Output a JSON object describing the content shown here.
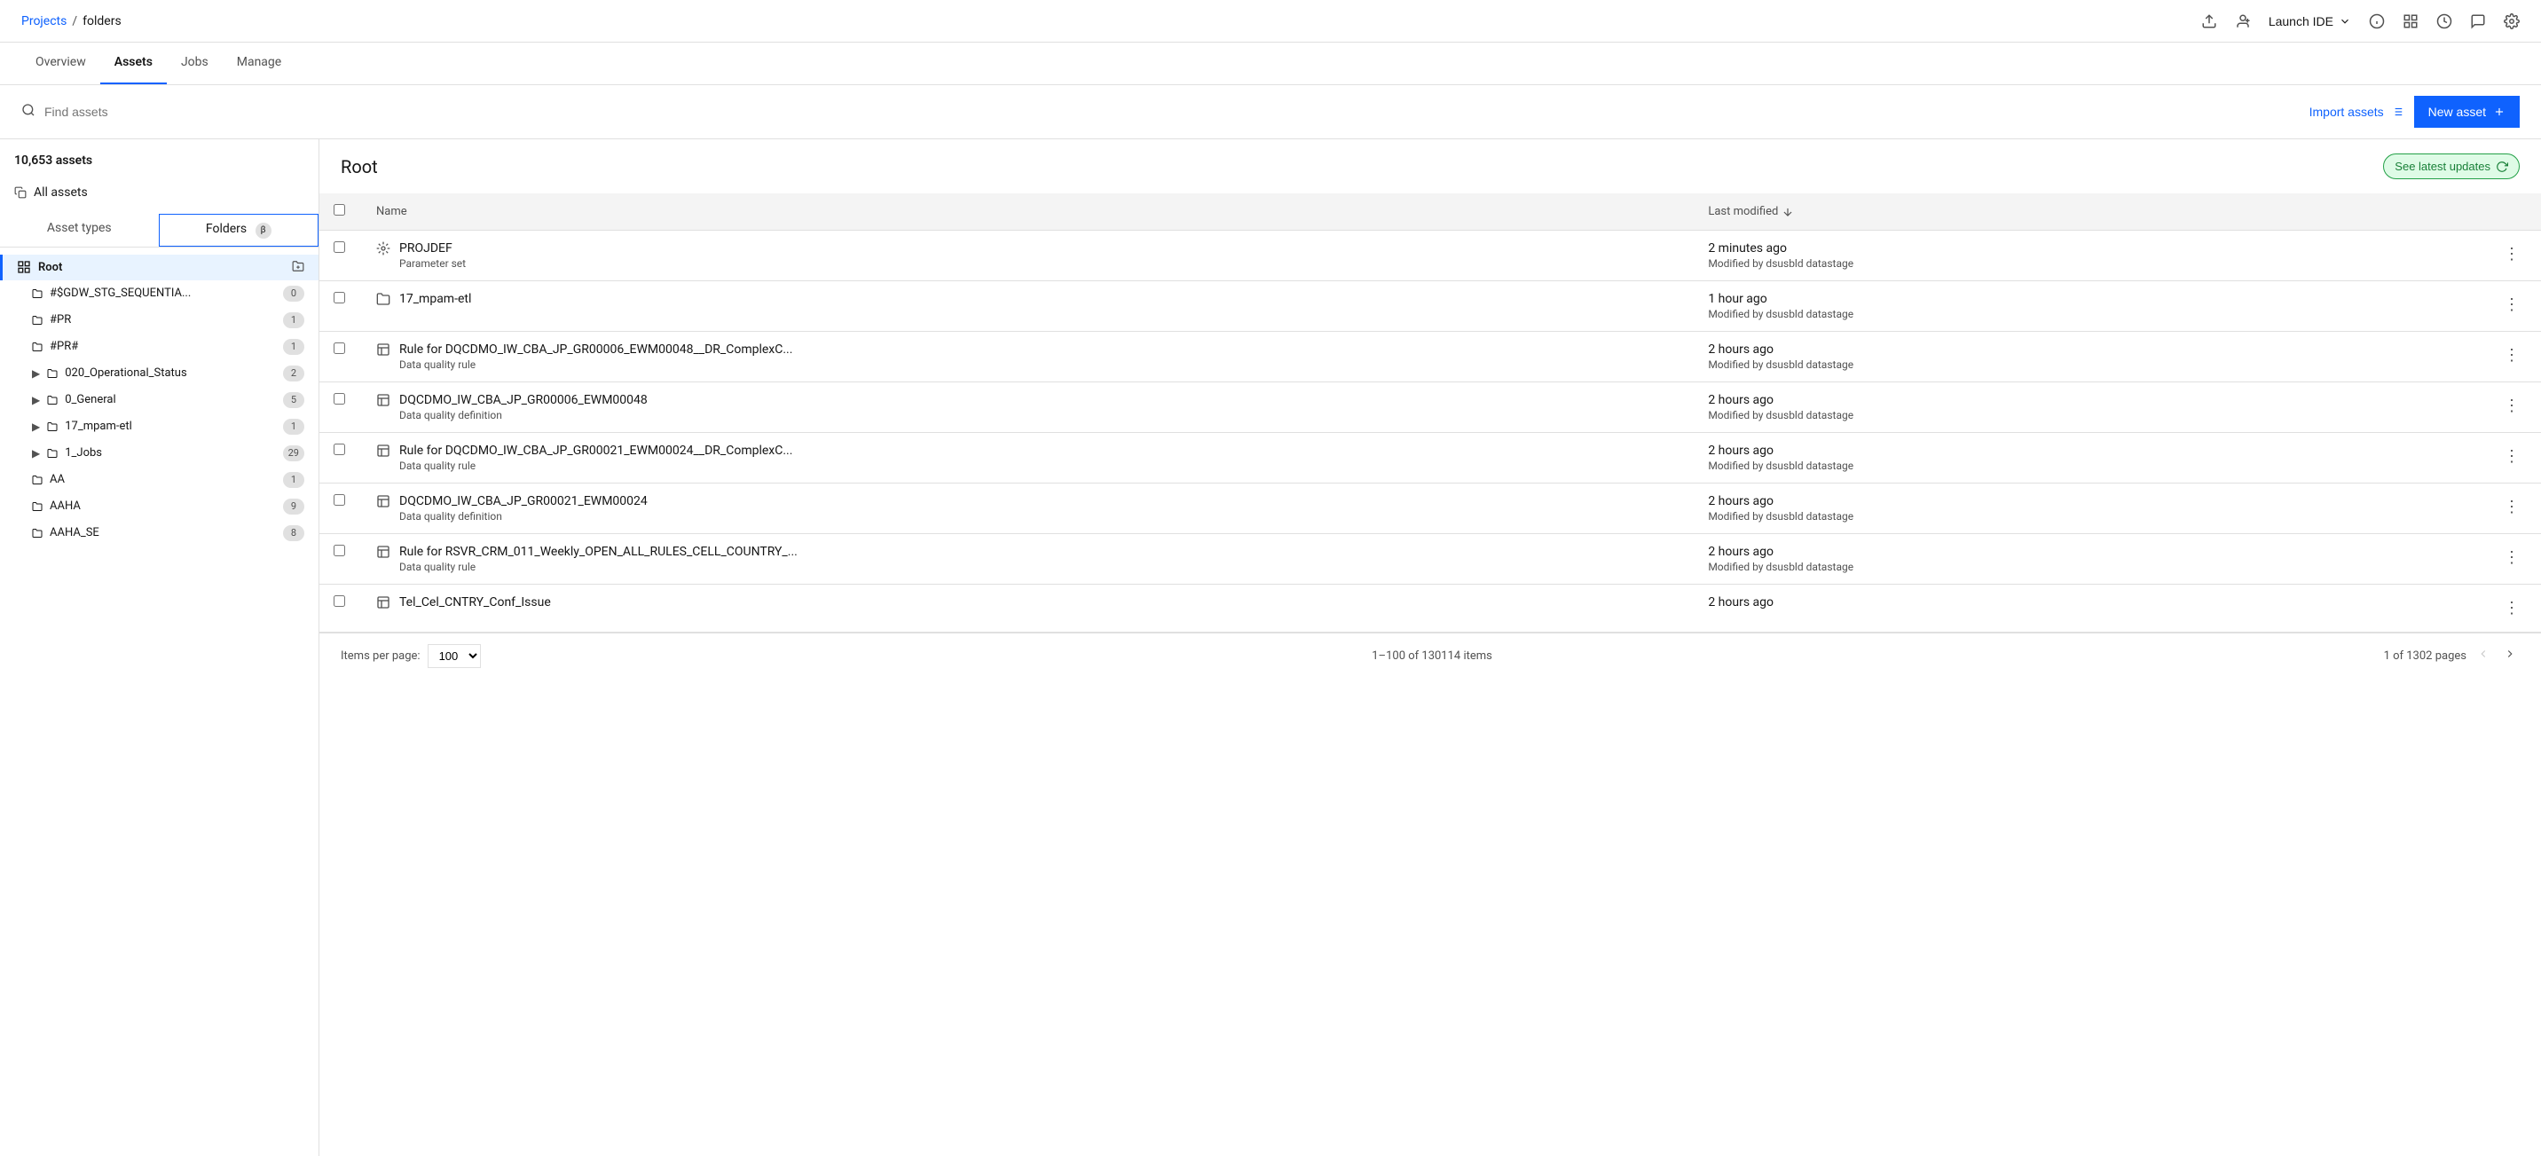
{
  "breadcrumb": {
    "projects_label": "Projects",
    "separator": "/",
    "current": "folders"
  },
  "topnav": {
    "launch_ide": "Launch IDE",
    "icons": [
      "upload-icon",
      "add-user-icon",
      "info-icon",
      "layout-icon",
      "history-icon",
      "chat-icon",
      "settings-icon"
    ]
  },
  "tabs": [
    {
      "label": "Overview",
      "active": false
    },
    {
      "label": "Assets",
      "active": true
    },
    {
      "label": "Jobs",
      "active": false
    },
    {
      "label": "Manage",
      "active": false
    }
  ],
  "toolbar": {
    "search_placeholder": "Find assets",
    "import_assets_label": "Import assets",
    "new_asset_label": "New asset"
  },
  "sidebar": {
    "assets_count": "10,653 assets",
    "all_assets_label": "All assets",
    "tabs": [
      {
        "label": "Asset types",
        "active": false
      },
      {
        "label": "Folders",
        "active": true,
        "badge": "β"
      }
    ],
    "folders": [
      {
        "name": "Root",
        "count": "",
        "level": 0,
        "root": true,
        "expanded": true,
        "has_children": false
      },
      {
        "name": "#$GDW_STG_SEQUENTIA...",
        "count": "0",
        "level": 1,
        "expanded": false,
        "has_children": false
      },
      {
        "name": "#PR",
        "count": "1",
        "level": 1,
        "expanded": false,
        "has_children": false
      },
      {
        "name": "#PR#",
        "count": "1",
        "level": 1,
        "expanded": false,
        "has_children": false
      },
      {
        "name": "020_Operational_Status",
        "count": "2",
        "level": 1,
        "expanded": false,
        "has_children": true
      },
      {
        "name": "0_General",
        "count": "5",
        "level": 1,
        "expanded": false,
        "has_children": true
      },
      {
        "name": "17_mpam-etl",
        "count": "1",
        "level": 1,
        "expanded": false,
        "has_children": true
      },
      {
        "name": "1_Jobs",
        "count": "29",
        "level": 1,
        "expanded": false,
        "has_children": true
      },
      {
        "name": "AA",
        "count": "1",
        "level": 1,
        "expanded": false,
        "has_children": false
      },
      {
        "name": "AAHA",
        "count": "9",
        "level": 1,
        "expanded": false,
        "has_children": false
      },
      {
        "name": "AAHA_SE",
        "count": "8",
        "level": 1,
        "expanded": false,
        "has_children": false
      }
    ]
  },
  "content": {
    "folder_title": "Root",
    "see_latest_label": "See latest updates",
    "table_headers": {
      "name": "Name",
      "last_modified": "Last modified"
    },
    "assets": [
      {
        "icon": "param-set",
        "name": "PROJDEF",
        "type": "Parameter set",
        "modified_time": "2 minutes ago",
        "modified_by": "Modified by dsusbld datastage"
      },
      {
        "icon": "folder",
        "name": "17_mpam-etl",
        "type": "",
        "modified_time": "1 hour ago",
        "modified_by": "Modified by dsusbld datastage"
      },
      {
        "icon": "data-quality-rule",
        "name": "Rule for DQCDMO_IW_CBA_JP_GR00006_EWM00048__DR_ComplexC...",
        "type": "Data quality rule",
        "modified_time": "2 hours ago",
        "modified_by": "Modified by dsusbld datastage"
      },
      {
        "icon": "data-quality-def",
        "name": "DQCDMO_IW_CBA_JP_GR00006_EWM00048",
        "type": "Data quality definition",
        "modified_time": "2 hours ago",
        "modified_by": "Modified by dsusbld datastage"
      },
      {
        "icon": "data-quality-rule",
        "name": "Rule for DQCDMO_IW_CBA_JP_GR00021_EWM00024__DR_ComplexC...",
        "type": "Data quality rule",
        "modified_time": "2 hours ago",
        "modified_by": "Modified by dsusbld datastage"
      },
      {
        "icon": "data-quality-def",
        "name": "DQCDMO_IW_CBA_JP_GR00021_EWM00024",
        "type": "Data quality definition",
        "modified_time": "2 hours ago",
        "modified_by": "Modified by dsusbld datastage"
      },
      {
        "icon": "data-quality-rule",
        "name": "Rule for RSVR_CRM_011_Weekly_OPEN_ALL_RULES_CELL_COUNTRY_...",
        "type": "Data quality rule",
        "modified_time": "2 hours ago",
        "modified_by": "Modified by dsusbld datastage"
      },
      {
        "icon": "data-quality-def",
        "name": "Tel_Cel_CNTRY_Conf_Issue",
        "type": "",
        "modified_time": "2 hours ago",
        "modified_by": ""
      }
    ],
    "footer": {
      "items_per_page_label": "Items per page:",
      "items_per_page_value": "100",
      "items_range": "1–100 of 130114 items",
      "page_info": "1 of 1302 pages"
    }
  }
}
